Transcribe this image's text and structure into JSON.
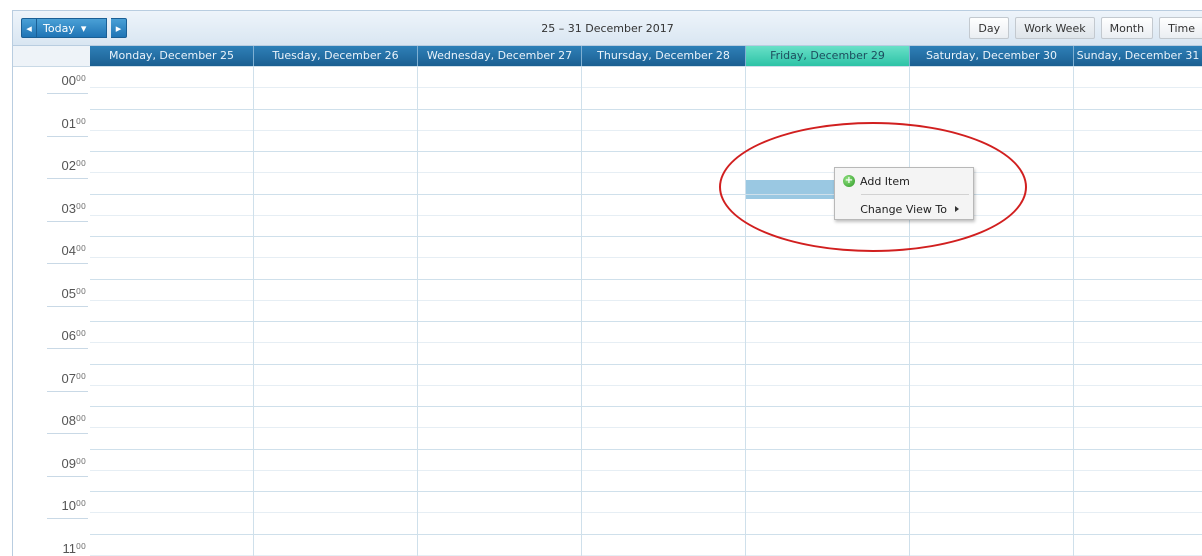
{
  "toolbar": {
    "prev_icon": "◂",
    "today_label": "Today",
    "dropdown_icon": "▾",
    "next_icon": "▸",
    "range_title": "25 – 31 December 2017",
    "views": [
      "Day",
      "Work Week",
      "Month",
      "Time"
    ],
    "active_view": "Work Week"
  },
  "calendar": {
    "days": [
      {
        "label": "Monday, December 25"
      },
      {
        "label": "Tuesday, December 26"
      },
      {
        "label": "Wednesday, December 27"
      },
      {
        "label": "Thursday, December 28"
      },
      {
        "label": "Friday, December 29",
        "today": true
      },
      {
        "label": "Saturday, December 30"
      },
      {
        "label": "Sunday, December 31"
      }
    ],
    "hours": [
      "00",
      "01",
      "02",
      "03",
      "04",
      "05",
      "06",
      "07",
      "08",
      "09",
      "10",
      "11"
    ],
    "minute_label": "00",
    "selected_slot": {
      "day": "Friday, December 29",
      "hour": "02"
    }
  },
  "context_menu": {
    "add_item_label": "Add Item",
    "change_view_label": "Change View To"
  },
  "colors": {
    "header_blue": "#1b5f91",
    "today_header": "#2cc3a6",
    "selection": "#9ac8e2",
    "annotation_circle": "#d11f1f"
  }
}
